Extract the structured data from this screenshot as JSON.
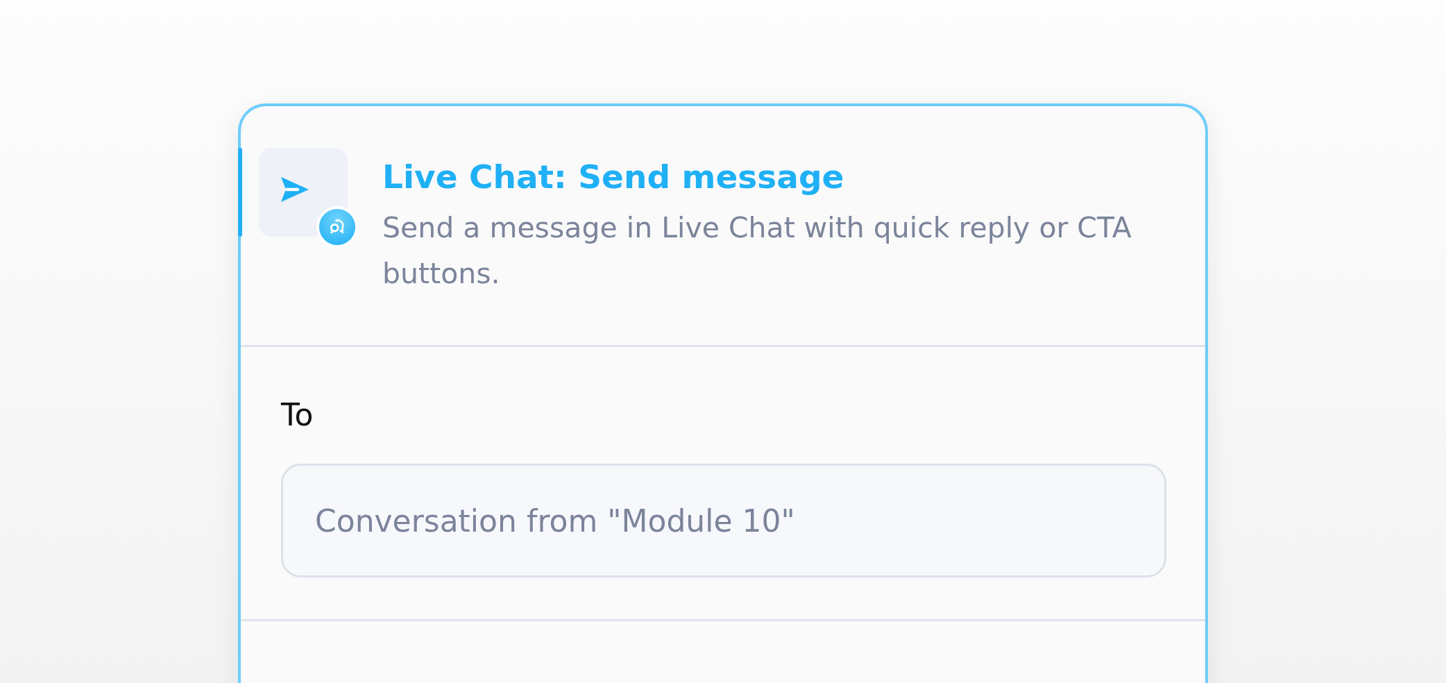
{
  "card": {
    "title": "Live Chat: Send message",
    "description": "Send a message in Live Chat with quick reply or CTA buttons.",
    "selected": true,
    "fields": [
      {
        "label": "To",
        "value": "Conversation from \"Module 10\""
      }
    ]
  }
}
